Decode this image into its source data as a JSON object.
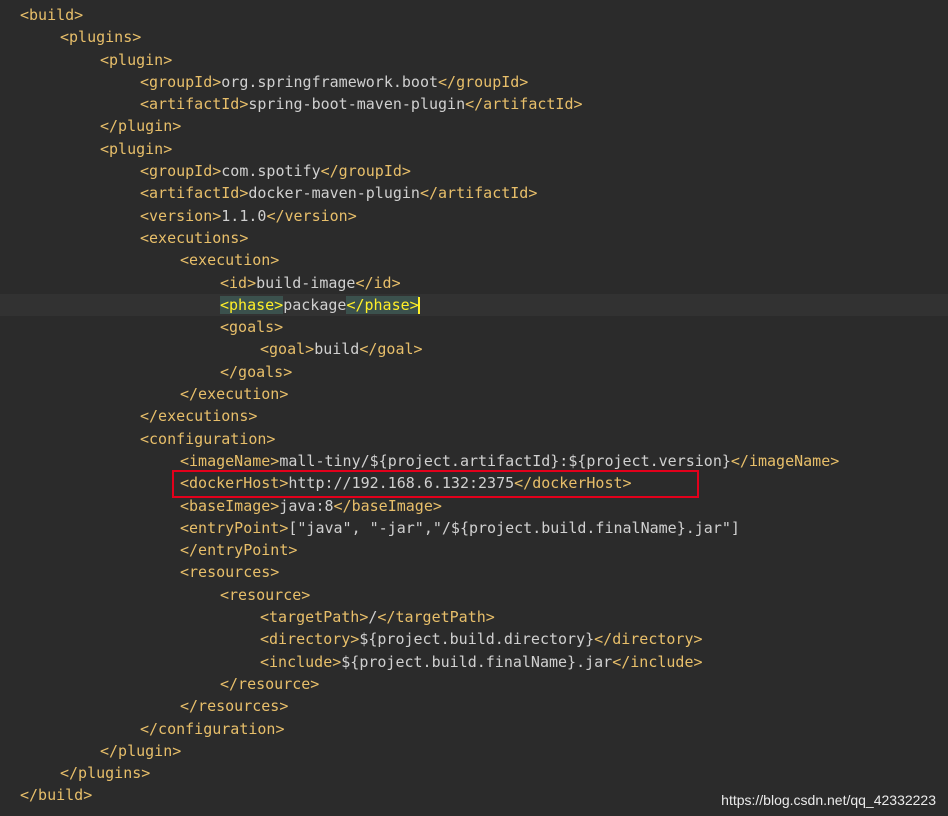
{
  "editor": {
    "lines": [
      {
        "indent": 0,
        "parts": [
          [
            "tag",
            "<build>"
          ]
        ]
      },
      {
        "indent": 1,
        "parts": [
          [
            "tag",
            "<plugins>"
          ]
        ]
      },
      {
        "indent": 2,
        "parts": [
          [
            "tag",
            "<plugin>"
          ]
        ]
      },
      {
        "indent": 3,
        "parts": [
          [
            "tag",
            "<groupId>"
          ],
          [
            "txt",
            "org.springframework.boot"
          ],
          [
            "tag",
            "</groupId>"
          ]
        ]
      },
      {
        "indent": 3,
        "parts": [
          [
            "tag",
            "<artifactId>"
          ],
          [
            "txt",
            "spring-boot-maven-plugin"
          ],
          [
            "tag",
            "</artifactId>"
          ]
        ]
      },
      {
        "indent": 2,
        "parts": [
          [
            "tag",
            "</plugin>"
          ]
        ]
      },
      {
        "indent": 2,
        "parts": [
          [
            "tag",
            "<plugin>"
          ]
        ]
      },
      {
        "indent": 3,
        "parts": [
          [
            "tag",
            "<groupId>"
          ],
          [
            "txt",
            "com.spotify"
          ],
          [
            "tag",
            "</groupId>"
          ]
        ]
      },
      {
        "indent": 3,
        "parts": [
          [
            "tag",
            "<artifactId>"
          ],
          [
            "txt",
            "docker-maven-plugin"
          ],
          [
            "tag",
            "</artifactId>"
          ]
        ]
      },
      {
        "indent": 3,
        "parts": [
          [
            "tag",
            "<version>"
          ],
          [
            "txt",
            "1.1.0"
          ],
          [
            "tag",
            "</version>"
          ]
        ]
      },
      {
        "indent": 3,
        "parts": [
          [
            "tag",
            "<executions>"
          ]
        ]
      },
      {
        "indent": 4,
        "parts": [
          [
            "tag",
            "<execution>"
          ]
        ]
      },
      {
        "indent": 5,
        "parts": [
          [
            "tag",
            "<id>"
          ],
          [
            "txt",
            "build-image"
          ],
          [
            "tag",
            "</id>"
          ]
        ]
      },
      {
        "indent": 5,
        "current": true,
        "parts": [
          [
            "hl",
            "<phase>"
          ],
          [
            "txt",
            "package"
          ],
          [
            "hl",
            "</phase>"
          ],
          [
            "cursor",
            ""
          ]
        ]
      },
      {
        "indent": 5,
        "parts": [
          [
            "tag",
            "<goals>"
          ]
        ]
      },
      {
        "indent": 6,
        "parts": [
          [
            "tag",
            "<goal>"
          ],
          [
            "txt",
            "build"
          ],
          [
            "tag",
            "</goal>"
          ]
        ]
      },
      {
        "indent": 5,
        "parts": [
          [
            "tag",
            "</goals>"
          ]
        ]
      },
      {
        "indent": 4,
        "parts": [
          [
            "tag",
            "</execution>"
          ]
        ]
      },
      {
        "indent": 3,
        "parts": [
          [
            "tag",
            "</executions>"
          ]
        ]
      },
      {
        "indent": 3,
        "parts": [
          [
            "tag",
            "<configuration>"
          ]
        ]
      },
      {
        "indent": 4,
        "parts": [
          [
            "tag",
            "<imageName>"
          ],
          [
            "txt",
            "mall-tiny/${project.artifactId}:${project.version}"
          ],
          [
            "tag",
            "</imageName>"
          ]
        ]
      },
      {
        "indent": 4,
        "parts": [
          [
            "tag",
            "<dockerHost>"
          ],
          [
            "txt",
            "http://192.168.6.132:2375"
          ],
          [
            "tag",
            "</dockerHost>"
          ]
        ]
      },
      {
        "indent": 4,
        "parts": [
          [
            "tag",
            "<baseImage>"
          ],
          [
            "txt",
            "java:8"
          ],
          [
            "tag",
            "</baseImage>"
          ]
        ]
      },
      {
        "indent": 4,
        "parts": [
          [
            "tag",
            "<entryPoint>"
          ],
          [
            "txt",
            "[\"java\", \"-jar\",\"/${project.build.finalName}.jar\"]"
          ]
        ]
      },
      {
        "indent": 4,
        "parts": [
          [
            "tag",
            "</entryPoint>"
          ]
        ]
      },
      {
        "indent": 4,
        "parts": [
          [
            "tag",
            "<resources>"
          ]
        ]
      },
      {
        "indent": 5,
        "parts": [
          [
            "tag",
            "<resource>"
          ]
        ]
      },
      {
        "indent": 6,
        "parts": [
          [
            "tag",
            "<targetPath>"
          ],
          [
            "txt",
            "/"
          ],
          [
            "tag",
            "</targetPath>"
          ]
        ]
      },
      {
        "indent": 6,
        "parts": [
          [
            "tag",
            "<directory>"
          ],
          [
            "txt",
            "${project.build.directory}"
          ],
          [
            "tag",
            "</directory>"
          ]
        ]
      },
      {
        "indent": 6,
        "parts": [
          [
            "tag",
            "<include>"
          ],
          [
            "txt",
            "${project.build.finalName}.jar"
          ],
          [
            "tag",
            "</include>"
          ]
        ]
      },
      {
        "indent": 5,
        "parts": [
          [
            "tag",
            "</resource>"
          ]
        ]
      },
      {
        "indent": 4,
        "parts": [
          [
            "tag",
            "</resources>"
          ]
        ]
      },
      {
        "indent": 3,
        "parts": [
          [
            "tag",
            "</configuration>"
          ]
        ]
      },
      {
        "indent": 2,
        "parts": [
          [
            "tag",
            "</plugin>"
          ]
        ]
      },
      {
        "indent": 1,
        "parts": [
          [
            "tag",
            "</plugins>"
          ]
        ]
      },
      {
        "indent": 0,
        "parts": [
          [
            "tag",
            "</build>"
          ]
        ]
      }
    ]
  },
  "watermark": {
    "text": "https://blog.csdn.net/qq_42332223"
  },
  "colors": {
    "background": "#2b2b2b",
    "tag": "#e8bf6a",
    "text": "#d0d0d0",
    "highlight_box": "#e3001b",
    "bracket_highlight": "#ffef28"
  }
}
